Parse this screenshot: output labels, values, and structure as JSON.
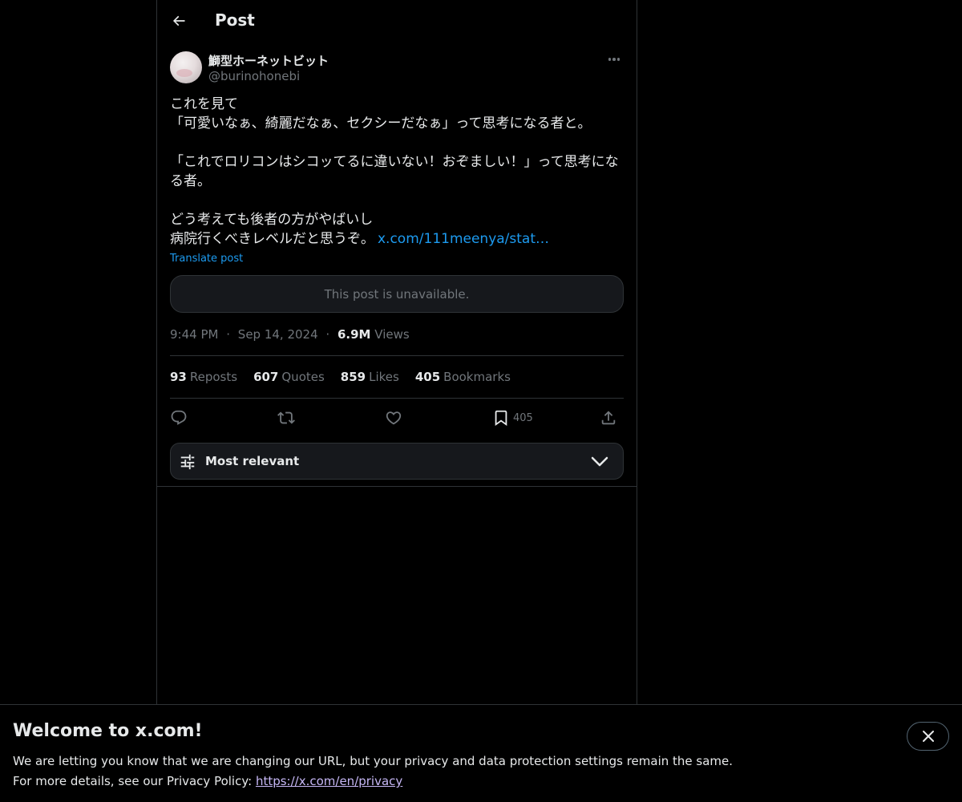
{
  "header": {
    "title": "Post"
  },
  "author": {
    "name": "鰤型ホーネットビット",
    "handle": "@burinohonebi"
  },
  "post": {
    "lines": [
      "これを見て",
      "「可愛いなぁ、綺麗だなぁ、セクシーだなぁ」って思考になる者と。",
      "",
      "「これでロリコンはシコッてるに違いない！おぞましい！」って思考にな",
      "る者。",
      "",
      "どう考えても後者の方がやばいし",
      "病院行くべきレベルだと思うぞ。"
    ],
    "link_text": "x.com/111meenya/stat…",
    "translate_label": "Translate post",
    "quoted_unavailable": "This post is unavailable."
  },
  "meta": {
    "time": "9:44 PM",
    "separator": "·",
    "date": "Sep 14, 2024",
    "views_count": "6.9M",
    "views_label": "Views"
  },
  "stats": {
    "reposts": {
      "count": "93",
      "label": "Reposts"
    },
    "quotes": {
      "count": "607",
      "label": "Quotes"
    },
    "likes": {
      "count": "859",
      "label": "Likes"
    },
    "bookmarks": {
      "count": "405",
      "label": "Bookmarks"
    }
  },
  "actions": {
    "bookmark_count": "405"
  },
  "sort": {
    "label": "Most relevant"
  },
  "banner": {
    "title": "Welcome to x.com!",
    "line1": "We are letting you know that we are changing our URL, but your privacy and data protection settings remain the same.",
    "line2_prefix": "For more details, see our Privacy Policy: ",
    "link": "https://x.com/en/privacy"
  },
  "colors": {
    "background": "#000000",
    "accent": "#1d9bf0",
    "border": "#2f3336",
    "muted": "#71767b",
    "banner_link": "#c6b7f5"
  },
  "icons": [
    "arrow-left-icon",
    "more-icon",
    "reply-icon",
    "repost-icon",
    "like-icon",
    "bookmark-icon",
    "share-icon",
    "sliders-icon",
    "chevron-down-icon",
    "close-icon"
  ]
}
